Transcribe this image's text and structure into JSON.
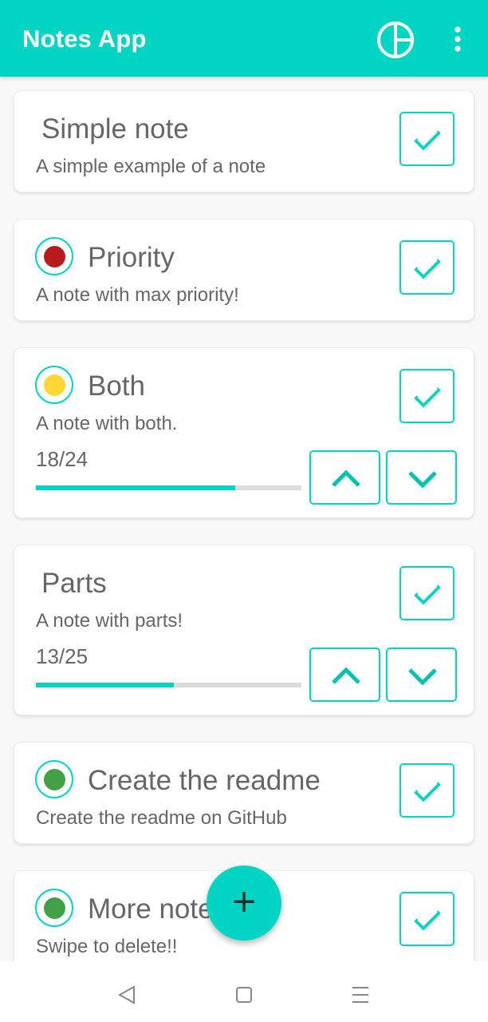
{
  "app": {
    "title": "Notes App"
  },
  "toolbar": {
    "chart_icon": "pie-chart-icon",
    "more_icon": "more-vert-icon"
  },
  "notes": [
    {
      "title": "Simple note",
      "description": "A simple example of a note",
      "priority": null,
      "checked": false
    },
    {
      "title": "Priority",
      "description": "A note with max priority!",
      "priority": "high",
      "priority_color": "#b71c1c",
      "checked": false
    },
    {
      "title": "Both",
      "description": "A note with both.",
      "priority": "medium",
      "priority_color": "#fdd835",
      "progress": {
        "text": "18/24",
        "done": 18,
        "total": 24
      },
      "checked": false
    },
    {
      "title": "Parts",
      "description": "A note with parts!",
      "priority": null,
      "progress": {
        "text": "13/25",
        "done": 13,
        "total": 25
      },
      "checked": false
    },
    {
      "title": "Create the readme",
      "description": "Create the readme on GitHub",
      "priority": "low",
      "priority_color": "#43a047",
      "checked": false
    },
    {
      "title": "More notes",
      "description": "Swipe to delete!!",
      "priority": "low",
      "priority_color": "#43a047",
      "checked": false
    }
  ],
  "fab": {
    "label": "+"
  },
  "navbar": {
    "back_icon": "back-triangle-icon",
    "home_icon": "home-square-icon",
    "recents_icon": "menu-lines-icon"
  },
  "colors": {
    "accent": "#00d5c4",
    "text": "#666666",
    "progress_track": "#dcdcdc"
  }
}
